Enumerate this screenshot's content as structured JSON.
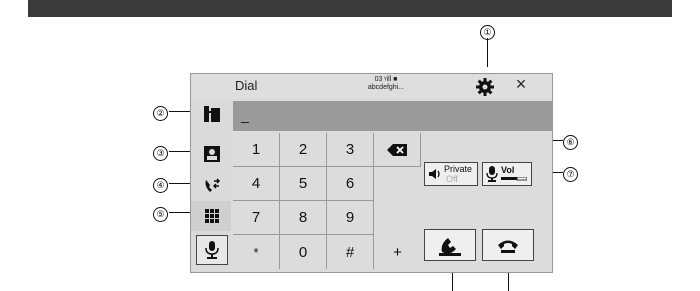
{
  "dial_screen": {
    "title": "Dial",
    "phone_info": {
      "line1": "03 ᵞill ■",
      "line2": "abcdefghi..."
    },
    "close_label": "×",
    "number_display": "_",
    "keypad": [
      "1",
      "2",
      "3",
      "4",
      "5",
      "6",
      "7",
      "8",
      "9",
      "*",
      "0",
      "#",
      "+"
    ],
    "private_button": {
      "label": "Private",
      "state": "Off"
    },
    "volume_button": {
      "label": "Vol"
    }
  },
  "callouts": [
    "①",
    "②",
    "③",
    "④",
    "⑤",
    "⑥",
    "⑦"
  ],
  "icons": [
    "settings-gear-icon",
    "close-icon",
    "favorites-icon",
    "contacts-icon",
    "call-history-icon",
    "dialpad-icon",
    "microphone-icon",
    "backspace-icon",
    "private-mode-icon",
    "mic-volume-icon",
    "make-call-icon",
    "end-call-icon"
  ],
  "colors": {
    "top_bar": "#3a3a3a",
    "screen_bg": "#dcdcdc",
    "number_bar": "#9a9a9a"
  }
}
